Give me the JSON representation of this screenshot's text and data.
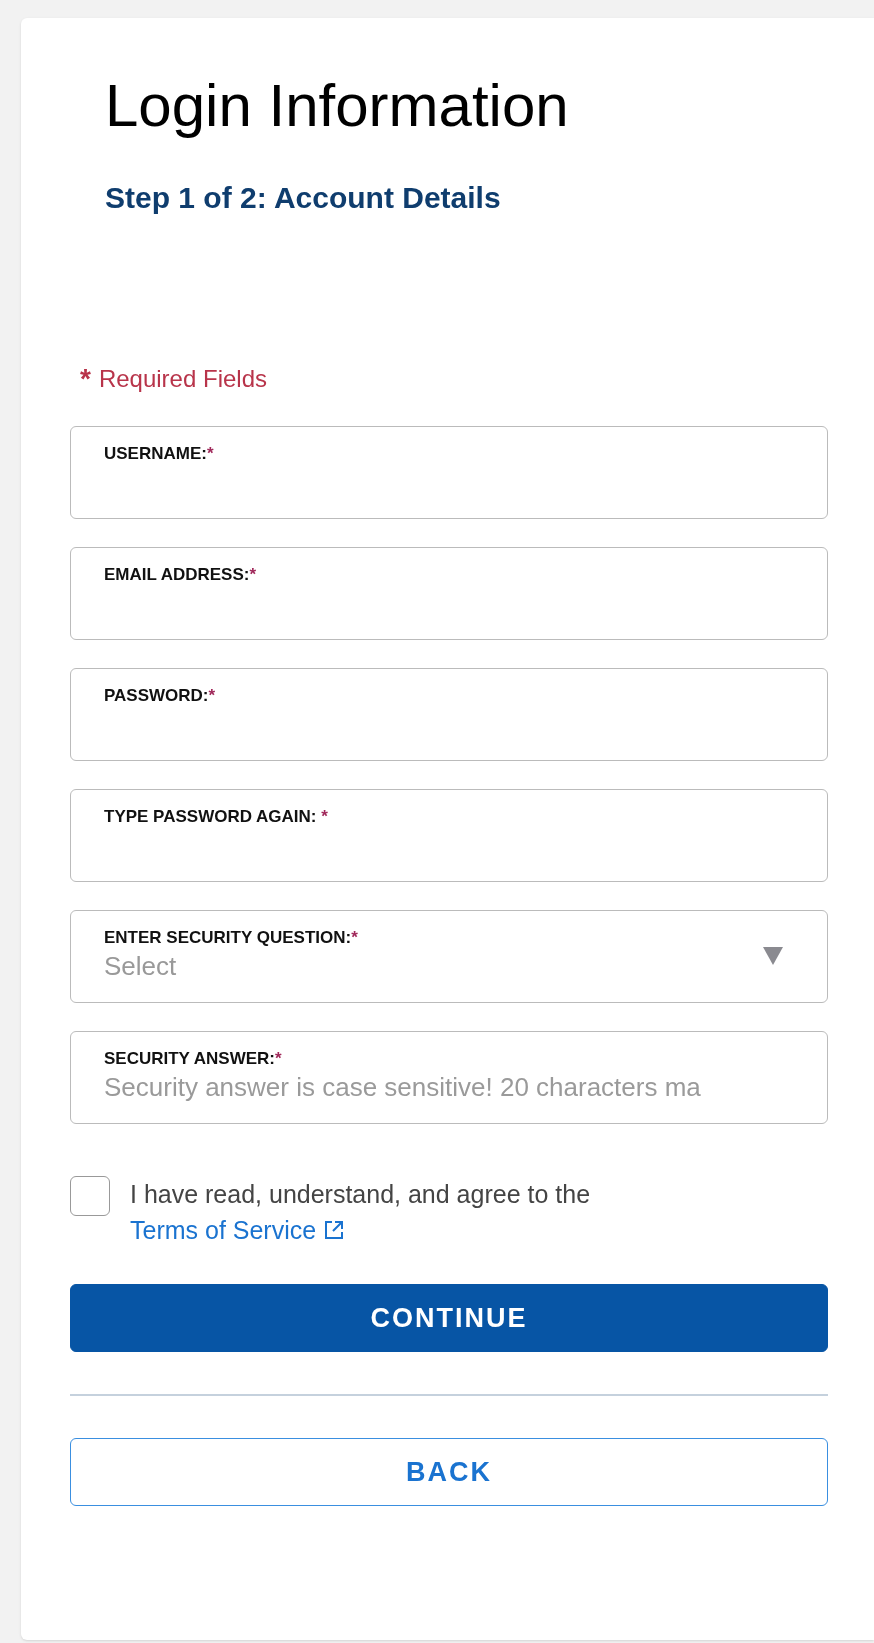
{
  "title": "Login Information",
  "step_heading": "Step 1 of 2: Account Details",
  "required_note": {
    "mark": "*",
    "text": "Required Fields"
  },
  "fields": [
    {
      "kind": "text",
      "label": "USERNAME:",
      "mark": "*"
    },
    {
      "kind": "text",
      "label": "EMAIL ADDRESS:",
      "mark": "*"
    },
    {
      "kind": "text",
      "label": "PASSWORD:",
      "mark": "*"
    },
    {
      "kind": "text",
      "label": "TYPE PASSWORD AGAIN: ",
      "mark": "*"
    },
    {
      "kind": "select",
      "label": "ENTER SECURITY QUESTION:",
      "mark": "*",
      "value": "Select"
    },
    {
      "kind": "text",
      "label": "SECURITY ANSWER:",
      "mark": "*",
      "placeholder": "Security answer is case sensitive! 20 characters ma"
    }
  ],
  "agreement": {
    "checked": false,
    "text": "I have read, understand, and agree to the ",
    "link": "Terms of Service"
  },
  "buttons": [
    {
      "kind": "primary",
      "label": "CONTINUE"
    },
    {
      "kind": "secondary",
      "label": "BACK"
    }
  ]
}
